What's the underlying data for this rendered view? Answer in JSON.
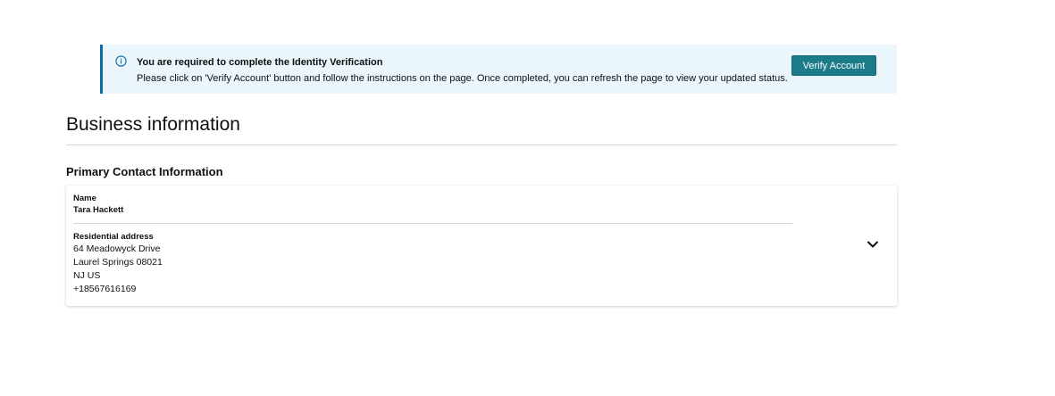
{
  "alert": {
    "icon": "info-icon",
    "title": "You are required to complete the Identity Verification",
    "description": "Please click on 'Verify Account' button and follow the instructions on the page. Once completed, you can refresh the page to view your updated status.",
    "button_label": "Verify Account",
    "accent_color": "#0b6aa8",
    "button_color": "#1b7b89"
  },
  "page": {
    "title": "Business information"
  },
  "contact": {
    "section_title": "Primary Contact Information",
    "name_label": "Name",
    "name_value": "Tara Hackett",
    "address_label": "Residential address",
    "address_lines": [
      "64 Meadowyck Drive",
      "Laurel Springs 08021",
      "NJ US",
      "+18567616169"
    ],
    "expand_icon": "chevron-down-icon"
  }
}
